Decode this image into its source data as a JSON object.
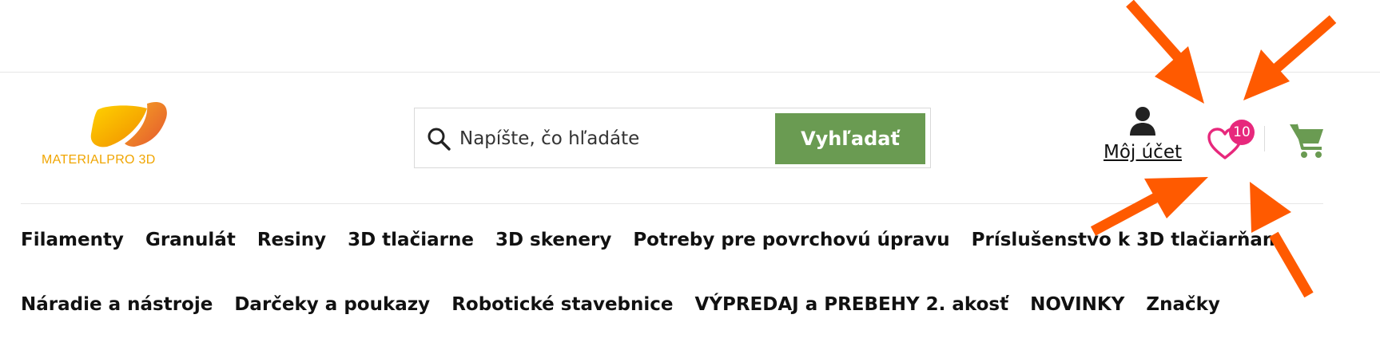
{
  "brand": {
    "logo_text": "MATERIALPRO 3D"
  },
  "search": {
    "placeholder": "Napíšte, čo hľadáte",
    "button_label": "Vyhľadať",
    "button_color": "#6a9b52"
  },
  "account": {
    "label": "Môj účet",
    "icon": "user-icon"
  },
  "wishlist": {
    "icon": "heart-icon",
    "count": "10",
    "badge_color": "#e7287c"
  },
  "cart": {
    "icon": "cart-icon",
    "color": "#6a9b52"
  },
  "nav": {
    "row1": [
      {
        "label": "Filamenty"
      },
      {
        "label": "Granulát"
      },
      {
        "label": "Resiny"
      },
      {
        "label": "3D tlačiarne"
      },
      {
        "label": "3D skenery"
      },
      {
        "label": "Potreby pre povrchovú úpravu"
      },
      {
        "label": "Príslušenstvo k 3D tlačiarňam"
      }
    ],
    "row2": [
      {
        "label": "Náradie a nástroje"
      },
      {
        "label": "Darčeky a poukazy"
      },
      {
        "label": "Robotické stavebnice"
      },
      {
        "label": "VÝPREDAJ a PREBEHY 2. akosť"
      },
      {
        "label": "NOVINKY"
      },
      {
        "label": "Značky"
      }
    ]
  },
  "annotation": {
    "arrow_color": "#ff5a00"
  }
}
